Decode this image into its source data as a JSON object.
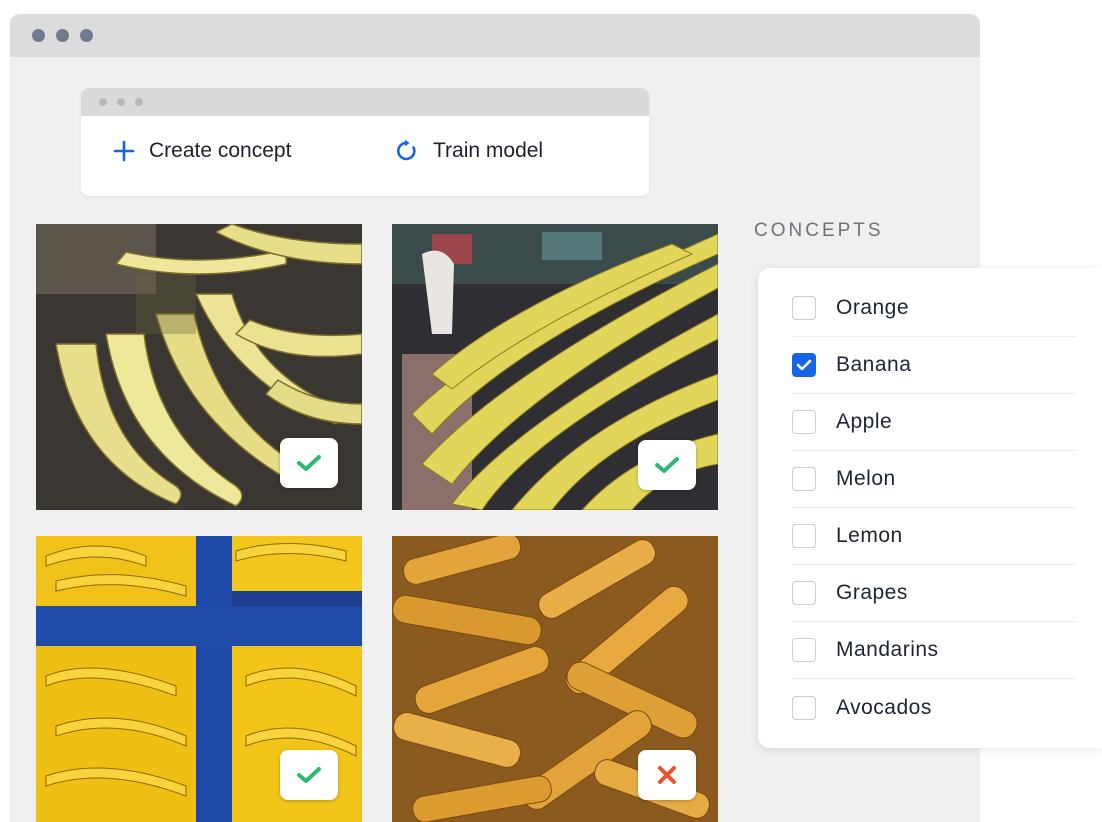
{
  "toolbar": {
    "create_label": "Create concept",
    "train_label": "Train model"
  },
  "concepts": {
    "title": "CONCEPTS",
    "items": [
      {
        "label": "Orange",
        "checked": false
      },
      {
        "label": "Banana",
        "checked": true
      },
      {
        "label": "Apple",
        "checked": false
      },
      {
        "label": "Melon",
        "checked": false
      },
      {
        "label": "Lemon",
        "checked": false
      },
      {
        "label": "Grapes",
        "checked": false
      },
      {
        "label": "Mandarins",
        "checked": false
      },
      {
        "label": "Avocados",
        "checked": false
      }
    ]
  },
  "images": [
    {
      "subject": "bananas",
      "status": "accepted"
    },
    {
      "subject": "bananas",
      "status": "accepted"
    },
    {
      "subject": "bananas",
      "status": "accepted"
    },
    {
      "subject": "corn",
      "status": "rejected"
    }
  ],
  "colors": {
    "accent": "#1864e8",
    "accept": "#2eb872",
    "reject": "#e8532a"
  },
  "icons": {
    "create": "plus-icon",
    "train": "refresh-icon",
    "accept": "check-icon",
    "reject": "x-icon"
  }
}
